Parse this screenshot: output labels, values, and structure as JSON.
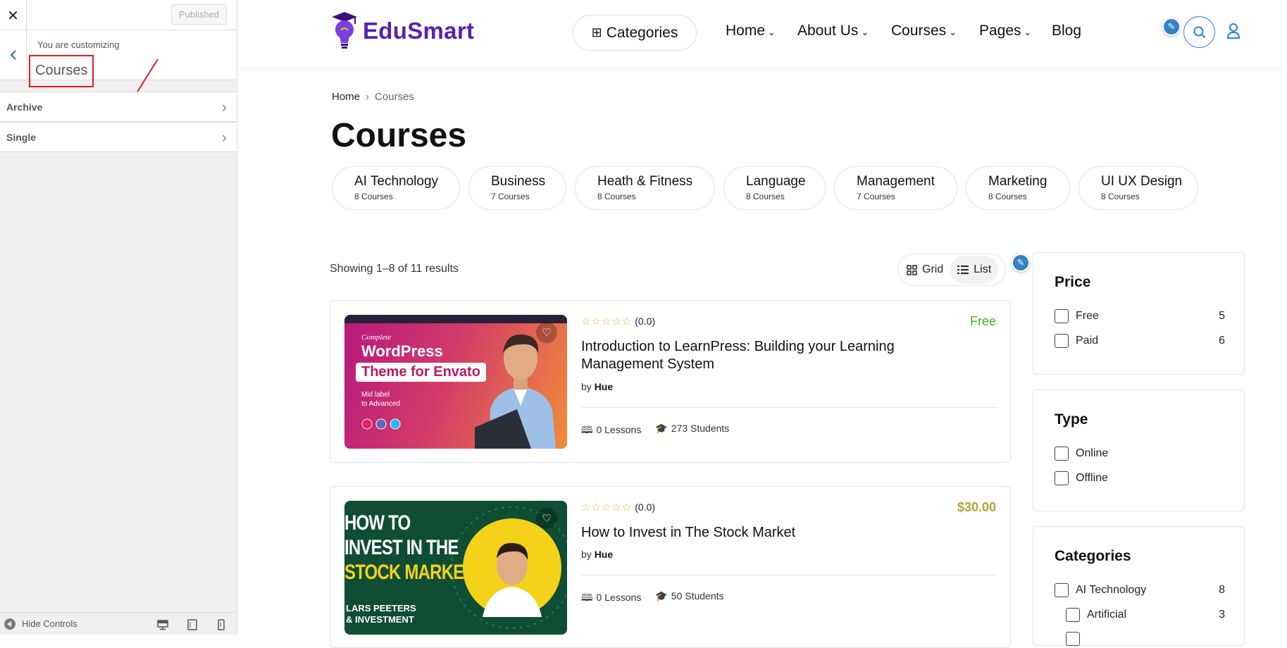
{
  "customizer": {
    "close_label": "✕",
    "publish_label": "Published",
    "info_label": "You are customizing",
    "title": "Courses",
    "sections": [
      {
        "label": "Archive"
      },
      {
        "label": "Single"
      }
    ],
    "hide_controls_label": "Hide Controls",
    "devices": [
      "desktop",
      "tablet",
      "mobile"
    ]
  },
  "header": {
    "logo_text": "EduSmart",
    "categories_label": "Categories",
    "nav": [
      {
        "label": "Home",
        "has_dropdown": true
      },
      {
        "label": "About Us",
        "has_dropdown": true
      },
      {
        "label": "Courses",
        "has_dropdown": true
      },
      {
        "label": "Pages",
        "has_dropdown": true
      },
      {
        "label": "Blog",
        "has_dropdown": false
      }
    ]
  },
  "breadcrumb": {
    "home": "Home",
    "current": "Courses"
  },
  "page_title": "Courses",
  "category_pills": [
    {
      "name": "AI Technology",
      "count": "8 Courses"
    },
    {
      "name": "Business",
      "count": "7 Courses"
    },
    {
      "name": "Heath & Fitness",
      "count": "8 Courses"
    },
    {
      "name": "Language",
      "count": "8 Courses"
    },
    {
      "name": "Management",
      "count": "7 Courses"
    },
    {
      "name": "Marketing",
      "count": "8 Courses"
    },
    {
      "name": "UI UX Design",
      "count": "8 Courses"
    }
  ],
  "results_text": "Showing 1–8 of 11 results",
  "view_toggle": {
    "grid": "Grid",
    "list": "List",
    "active": "list"
  },
  "courses": [
    {
      "rating": "(0.0)",
      "price": "Free",
      "price_color": "#3fae29",
      "title": "Introduction to LearnPress: Building your Learning Management System",
      "by_label": "by",
      "author": "Hue",
      "lessons": "0 Lessons",
      "students": "273 Students",
      "thumb": {
        "line1": "Complete",
        "line2": "WordPress",
        "line3": "Theme for Envato",
        "line4": "Mid label",
        "line5": "to Advanced"
      }
    },
    {
      "rating": "(0.0)",
      "price": "$30.00",
      "price_color": "#b8a12e",
      "title": "How to Invest in The Stock Market",
      "by_label": "by",
      "author": "Hue",
      "lessons": "0 Lessons",
      "students": "50 Students",
      "thumb": {
        "line1": "HOW TO",
        "line2": "INVEST IN THE",
        "line3": "STOCK MARKET",
        "line4": "LARS PEETERS",
        "line5": "& INVESTMENT"
      }
    }
  ],
  "filters": {
    "price": {
      "title": "Price",
      "options": [
        {
          "label": "Free",
          "count": "5"
        },
        {
          "label": "Paid",
          "count": "6"
        }
      ]
    },
    "type": {
      "title": "Type",
      "options": [
        {
          "label": "Online"
        },
        {
          "label": "Offline"
        }
      ]
    },
    "categories": {
      "title": "Categories",
      "options": [
        {
          "label": "AI Technology",
          "count": "8"
        },
        {
          "label": "Artificial",
          "count": "3"
        }
      ]
    }
  },
  "colors": {
    "accent": "#2680eb",
    "brand": "#5a1fb0",
    "highlight_box": "#e31b23"
  }
}
